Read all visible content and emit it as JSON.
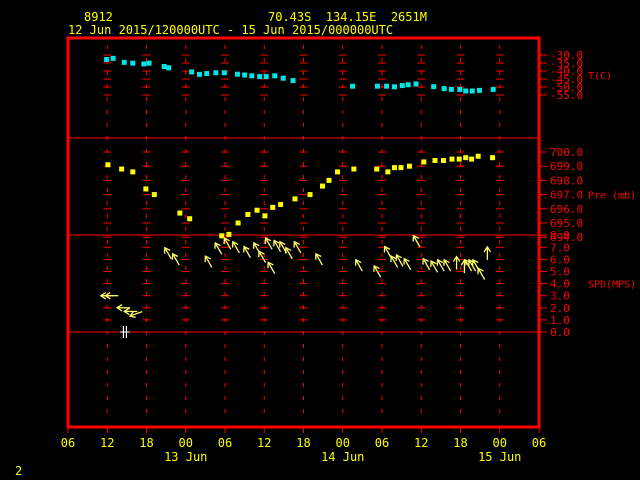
{
  "header": {
    "station_id": "8912",
    "location": "70.43S  134.15E  2651M",
    "period": "12 Jun 2015/120000UTC - 15 Jun 2015/000000UTC"
  },
  "footer": {
    "page_number": "2"
  },
  "colors": {
    "background": "#000000",
    "frame": "#ff0000",
    "grid": "#ff0000",
    "header_text": "#ffff00",
    "temperature": "#00e5e5",
    "pressure": "#ffff00",
    "wind": "#ffff66",
    "wind_fill": "#ffff00",
    "calm_marker": "#ffffff"
  },
  "chart_data": [
    {
      "type": "scatter",
      "panel": "top",
      "series": [
        {
          "name": "T(C)",
          "x": [
            11.9,
            12.9,
            14.6,
            15.9,
            17.6,
            18.4,
            20.7,
            21.4,
            24.9,
            26.1,
            27.2,
            28.6,
            29.9,
            31.9,
            33.0,
            34.1,
            35.3,
            36.3,
            37.6,
            38.9,
            40.4,
            49.5,
            53.3,
            54.7,
            55.9,
            57.1,
            58.0,
            59.2,
            61.9,
            63.5,
            64.6,
            65.9,
            66.8,
            67.8,
            68.9,
            71.0
          ],
          "y": [
            -32.8,
            -32.1,
            -34.6,
            -35.1,
            -35.6,
            -35.1,
            -37.2,
            -38.0,
            -40.6,
            -42.1,
            -41.6,
            -41.1,
            -41.1,
            -42.0,
            -42.5,
            -43.0,
            -43.5,
            -43.5,
            -43.0,
            -44.5,
            -46.0,
            -49.5,
            -49.5,
            -49.5,
            -49.9,
            -49.1,
            -48.6,
            -48.1,
            -49.8,
            -51.0,
            -51.5,
            -51.5,
            -52.5,
            -52.5,
            -52.1,
            -51.5
          ],
          "marker": "square"
        }
      ],
      "axis": {
        "label": "T(C)",
        "ticks": [
          -30.0,
          -35.0,
          -40.0,
          -45.0,
          -50.0,
          -55.0
        ],
        "ylim": [
          -27.5,
          -57.5
        ]
      }
    },
    {
      "type": "scatter",
      "panel": "middle",
      "series": [
        {
          "name": "Pre (mb)",
          "x": [
            12.1,
            14.2,
            15.9,
            17.9,
            19.2,
            23.1,
            24.6,
            29.5,
            30.6,
            32.0,
            33.5,
            34.9,
            36.1,
            37.3,
            38.5,
            40.7,
            43.0,
            44.9,
            45.9,
            47.2,
            49.7,
            53.2,
            54.9,
            55.9,
            56.9,
            58.2,
            60.4,
            62.1,
            63.4,
            64.7,
            65.8,
            66.8,
            67.7,
            68.7,
            70.9
          ],
          "y": [
            699.1,
            698.8,
            698.6,
            697.4,
            697.0,
            695.7,
            695.3,
            694.1,
            694.2,
            695.0,
            695.6,
            695.9,
            695.5,
            696.1,
            696.3,
            696.7,
            697.0,
            697.6,
            698.0,
            698.6,
            698.8,
            698.8,
            698.6,
            698.9,
            698.9,
            699.0,
            699.3,
            699.4,
            699.4,
            699.5,
            699.5,
            699.6,
            699.5,
            699.7,
            699.6
          ],
          "marker": "square"
        }
      ],
      "axis": {
        "label": "Pre (mb)",
        "ticks": [
          700.0,
          699.0,
          698.0,
          697.0,
          696.0,
          695.0,
          694.0
        ],
        "ylim": [
          693.6,
          701.0
        ]
      }
    },
    {
      "type": "scatter",
      "panel": "bottom",
      "series": [
        {
          "name": "SPD(MPS)",
          "x": [
            12.0,
            12.7,
            14.5,
            15.6,
            16.4,
            21.3,
            22.5,
            27.5,
            29.0,
            30.4,
            31.7,
            33.4,
            34.9,
            35.7,
            36.7,
            37.1,
            38.0,
            38.9,
            39.8,
            41.1,
            44.4,
            50.5,
            53.3,
            54.9,
            55.9,
            56.7,
            57.9,
            59.3,
            60.8,
            62.0,
            63.0,
            64.0,
            65.4,
            66.6,
            67.2,
            67.8,
            68.4,
            69.2,
            70.1
          ],
          "speed": [
            3.0,
            3.0,
            2.0,
            1.7,
            1.5,
            6.5,
            6.0,
            5.8,
            6.9,
            7.3,
            7.0,
            6.6,
            6.9,
            6.2,
            7.3,
            5.3,
            7.1,
            7.0,
            6.5,
            7.0,
            6.0,
            5.5,
            5.0,
            6.6,
            5.8,
            5.9,
            5.6,
            7.5,
            5.6,
            5.4,
            5.5,
            5.5,
            5.7,
            5.4,
            5.5,
            5.5,
            5.5,
            4.8,
            6.5
          ],
          "direction_deg": [
            270,
            270,
            270,
            270,
            250,
            330,
            330,
            330,
            330,
            330,
            330,
            330,
            330,
            330,
            330,
            330,
            330,
            330,
            330,
            330,
            330,
            330,
            330,
            330,
            330,
            330,
            330,
            330,
            330,
            330,
            330,
            330,
            0,
            0,
            330,
            330,
            330,
            330,
            0
          ],
          "marker": "wind-arrow"
        }
      ],
      "axis": {
        "label": "SPD(MPS)",
        "ticks": [
          8.0,
          7.0,
          6.0,
          5.0,
          4.0,
          3.0,
          2.0,
          1.0,
          0.0
        ],
        "ylim": [
          0.0,
          9.0
        ]
      }
    }
  ],
  "time_axis": {
    "hour_labels": [
      "06",
      "12",
      "18",
      "00",
      "06",
      "12",
      "18",
      "00",
      "06",
      "12",
      "18",
      "00",
      "06"
    ],
    "hour_values": [
      6,
      12,
      18,
      24,
      30,
      36,
      42,
      48,
      54,
      60,
      66,
      72,
      78
    ],
    "day_labels": [
      "13 Jun",
      "14 Jun",
      "15 Jun"
    ],
    "day_values": [
      24,
      48,
      72
    ],
    "xlim": [
      6,
      78
    ]
  },
  "calm_marker": {
    "x": 14.7,
    "speed": 0.0
  }
}
